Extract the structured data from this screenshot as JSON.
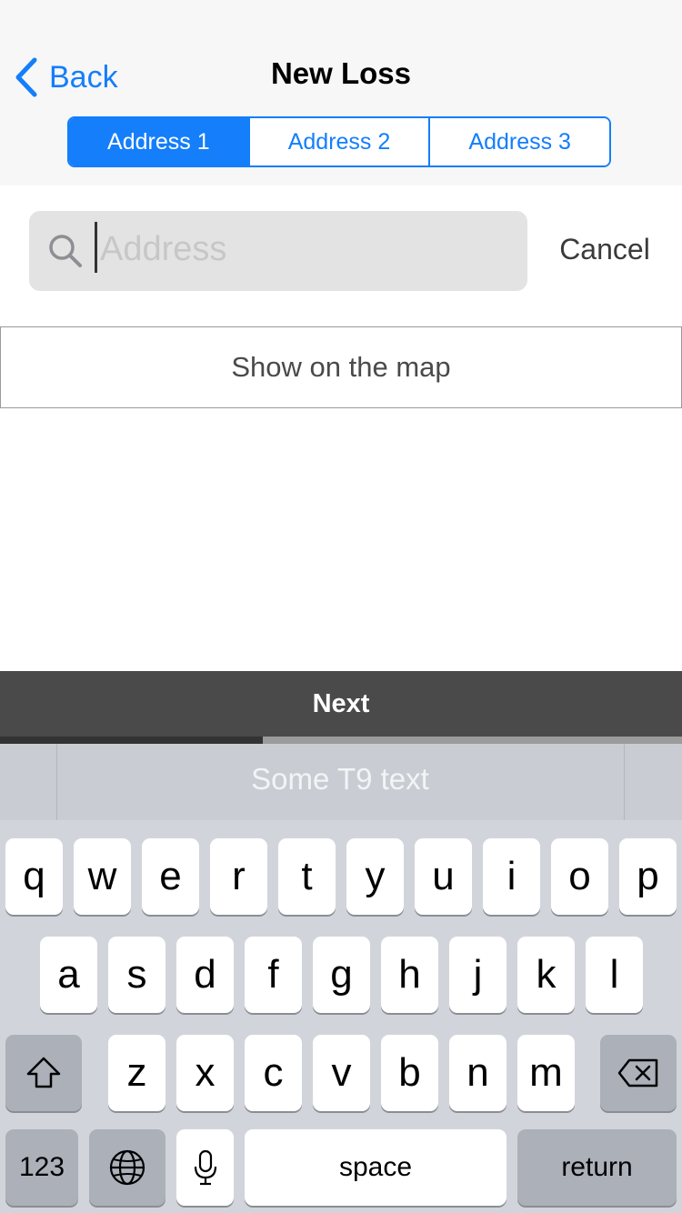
{
  "nav": {
    "back_label": "Back",
    "title": "New Loss",
    "tabs": [
      {
        "label": "Address 1",
        "selected": true
      },
      {
        "label": "Address 2",
        "selected": false
      },
      {
        "label": "Address 3",
        "selected": false
      }
    ]
  },
  "search": {
    "placeholder": "Address",
    "value": "",
    "cancel_label": "Cancel"
  },
  "show_map_label": "Show on the map",
  "next_label": "Next",
  "progress": 0.385,
  "keyboard": {
    "suggestion": "Some T9 text",
    "row1": [
      "q",
      "w",
      "e",
      "r",
      "t",
      "y",
      "u",
      "i",
      "o",
      "p"
    ],
    "row2": [
      "a",
      "s",
      "d",
      "f",
      "g",
      "h",
      "j",
      "k",
      "l"
    ],
    "row3": [
      "z",
      "x",
      "c",
      "v",
      "b",
      "n",
      "m"
    ],
    "numbers_label": "123",
    "space_label": "space",
    "return_label": "return"
  },
  "colors": {
    "accent": "#147efb",
    "next_bar": "#4a4a4a",
    "keyboard_bg": "#d1d5db"
  }
}
